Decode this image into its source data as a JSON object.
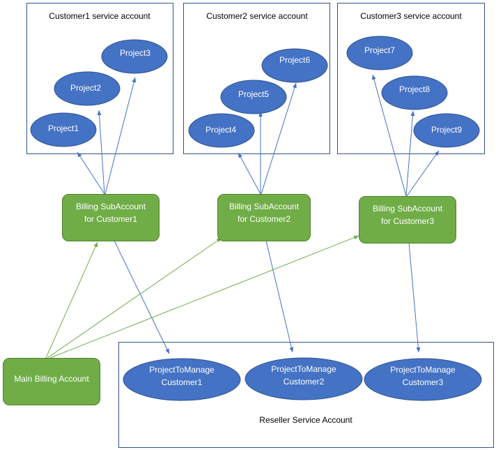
{
  "colors": {
    "project_fill": "#4472c4",
    "billing_fill": "#70ad47",
    "container_stroke": "#2f528f",
    "blue_arrow": "#4472c4",
    "green_arrow": "#70ad47"
  },
  "containers": [
    {
      "label": "Customer1 service account"
    },
    {
      "label": "Customer2 service account"
    },
    {
      "label": "Customer3 service account"
    },
    {
      "label": "Reseller Service Account"
    }
  ],
  "projects": [
    "Project1",
    "Project2",
    "Project3",
    "Project4",
    "Project5",
    "Project6",
    "Project7",
    "Project8",
    "Project9"
  ],
  "billing_subaccounts": [
    {
      "line1": "Billing SubAccount",
      "line2": "for Customer1"
    },
    {
      "line1": "Billing SubAccount",
      "line2": "for Customer2"
    },
    {
      "line1": "Billing SubAccount",
      "line2": "for Customer3"
    }
  ],
  "main_billing": "Main Billing Account",
  "managed_projects": [
    {
      "line1": "ProjectToManage",
      "line2": "Customer1"
    },
    {
      "line1": "ProjectToManage",
      "line2": "Customer2"
    },
    {
      "line1": "ProjectToManage",
      "line2": "Customer3"
    }
  ]
}
